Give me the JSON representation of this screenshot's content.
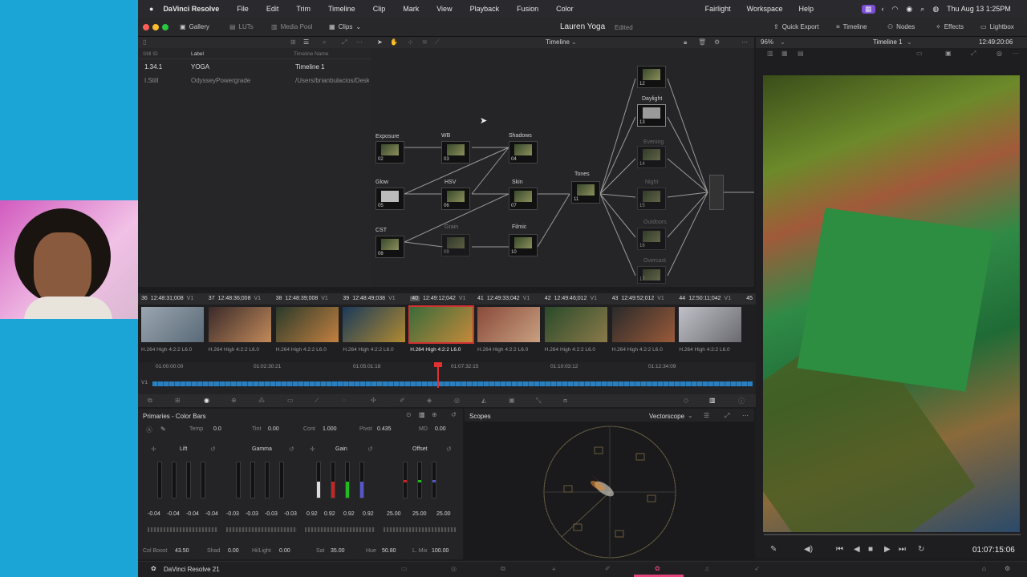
{
  "macbar": {
    "app_name": "DaVinci Resolve",
    "menus": [
      "File",
      "Edit",
      "Trim",
      "Timeline",
      "Clip",
      "Mark",
      "View",
      "Playback",
      "Fusion",
      "Color"
    ],
    "right_menus": [
      "Fairlight",
      "Workspace",
      "Help"
    ],
    "clock": "Thu Aug 13  1:25PM"
  },
  "toolbar": {
    "gallery": "Gallery",
    "luts": "LUTs",
    "media_pool": "Media Pool",
    "clips": "Clips",
    "project": "Lauren Yoga",
    "edited": "Edited",
    "quick_export": "Quick Export",
    "timeline": "Timeline",
    "nodes": "Nodes",
    "effects": "Effects",
    "lightbox": "Lightbox"
  },
  "gallery": {
    "col_still": "Still ID",
    "col_label": "Label",
    "col_tl": "Timeline Name",
    "rows": [
      {
        "id": "1.34.1",
        "label": "YOGA",
        "tl": "Timeline 1"
      },
      {
        "id": "I.Still",
        "label": "OdysseyPowergrade",
        "tl": "/Users/brianbulacios/Deskt"
      }
    ]
  },
  "node_editor": {
    "title": "Timeline",
    "zoom": "96%",
    "nodes": [
      {
        "label": "Exposure",
        "num": "02"
      },
      {
        "label": "WB",
        "num": "03"
      },
      {
        "label": "Shadows",
        "num": "04"
      },
      {
        "label": "Glow",
        "num": "05"
      },
      {
        "label": "HSV",
        "num": "06"
      },
      {
        "label": "Skin",
        "num": "07"
      },
      {
        "label": "CST",
        "num": "08"
      },
      {
        "label": "Grain",
        "num": "09"
      },
      {
        "label": "Filmic",
        "num": "10"
      },
      {
        "label": "Tones",
        "num": "11"
      },
      {
        "label": "",
        "num": "12"
      },
      {
        "label": "Daylight",
        "num": "13"
      },
      {
        "label": "Evening",
        "num": "14"
      },
      {
        "label": "Night",
        "num": "15"
      },
      {
        "label": "Outdoors",
        "num": "16"
      },
      {
        "label": "Overcast",
        "num": "17"
      }
    ]
  },
  "viewer": {
    "timeline": "Timeline 1",
    "timecode_top": "12:49:20:06",
    "timecode_bottom": "01:07:15:06"
  },
  "clips": [
    {
      "n": "36",
      "tc": "12:48:31;008",
      "v": "V1",
      "codec": "H.264 High 4:2:2 L6.0"
    },
    {
      "n": "37",
      "tc": "12:48:36;008",
      "v": "V1",
      "codec": "H.264 High 4:2:2 L6.0"
    },
    {
      "n": "38",
      "tc": "12:48:39;008",
      "v": "V1",
      "codec": "H.264 High 4:2:2 L6.0"
    },
    {
      "n": "39",
      "tc": "12:48:49;038",
      "v": "V1",
      "codec": "H.264 High 4:2:2 L6.0"
    },
    {
      "n": "40",
      "tc": "12:49:12;042",
      "v": "V1",
      "codec": "H.264 High 4:2:2 L6.0"
    },
    {
      "n": "41",
      "tc": "12:49:33;042",
      "v": "V1",
      "codec": "H.264 High 4:2:2 L6.0"
    },
    {
      "n": "42",
      "tc": "12:49:46;012",
      "v": "V1",
      "codec": "H.264 High 4:2:2 L6.0"
    },
    {
      "n": "43",
      "tc": "12:49:52;012",
      "v": "V1",
      "codec": "H.264 High 4:2:2 L6.0"
    },
    {
      "n": "44",
      "tc": "12:50:11;042",
      "v": "V1",
      "codec": "H.264 High 4:2:2 L6.0"
    },
    {
      "n": "45",
      "tc": "",
      "v": "",
      "codec": ""
    }
  ],
  "ruler": [
    "01:00:00:00",
    "01:02:30:21",
    "01:05:01:18",
    "01:07:32:15",
    "01:10:03:12",
    "01:12:34:09"
  ],
  "track": "V1",
  "primaries": {
    "title": "Primaries - Color Bars",
    "temp_label": "Temp",
    "temp": "0.0",
    "tint_label": "Tint",
    "tint": "0.00",
    "cont_label": "Cont",
    "cont": "1.000",
    "pivot_label": "Pivot",
    "pivot": "0.435",
    "md_label": "MD",
    "md": "0.00",
    "wheels": [
      {
        "name": "Lift",
        "vals": [
          "-0.04",
          "-0.04",
          "-0.04",
          "-0.04"
        ]
      },
      {
        "name": "Gamma",
        "vals": [
          "-0.03",
          "-0.03",
          "-0.03",
          "-0.03"
        ]
      },
      {
        "name": "Gain",
        "vals": [
          "0.92",
          "0.92",
          "0.92",
          "0.92"
        ]
      },
      {
        "name": "Offset",
        "vals": [
          "25.00",
          "25.00",
          "25.00"
        ]
      }
    ],
    "colboost_label": "Col Boost",
    "colboost": "43.50",
    "shad_label": "Shad",
    "shad": "0.00",
    "hl_label": "Hi/Light",
    "hl": "0.00",
    "sat_label": "Sat",
    "sat": "35.00",
    "hue_label": "Hue",
    "hue": "50.80",
    "lmix_label": "L. Mix",
    "lmix": "100.00"
  },
  "scopes": {
    "title": "Scopes",
    "mode": "Vectorscope"
  },
  "footer": {
    "app": "DaVinci Resolve 21"
  }
}
